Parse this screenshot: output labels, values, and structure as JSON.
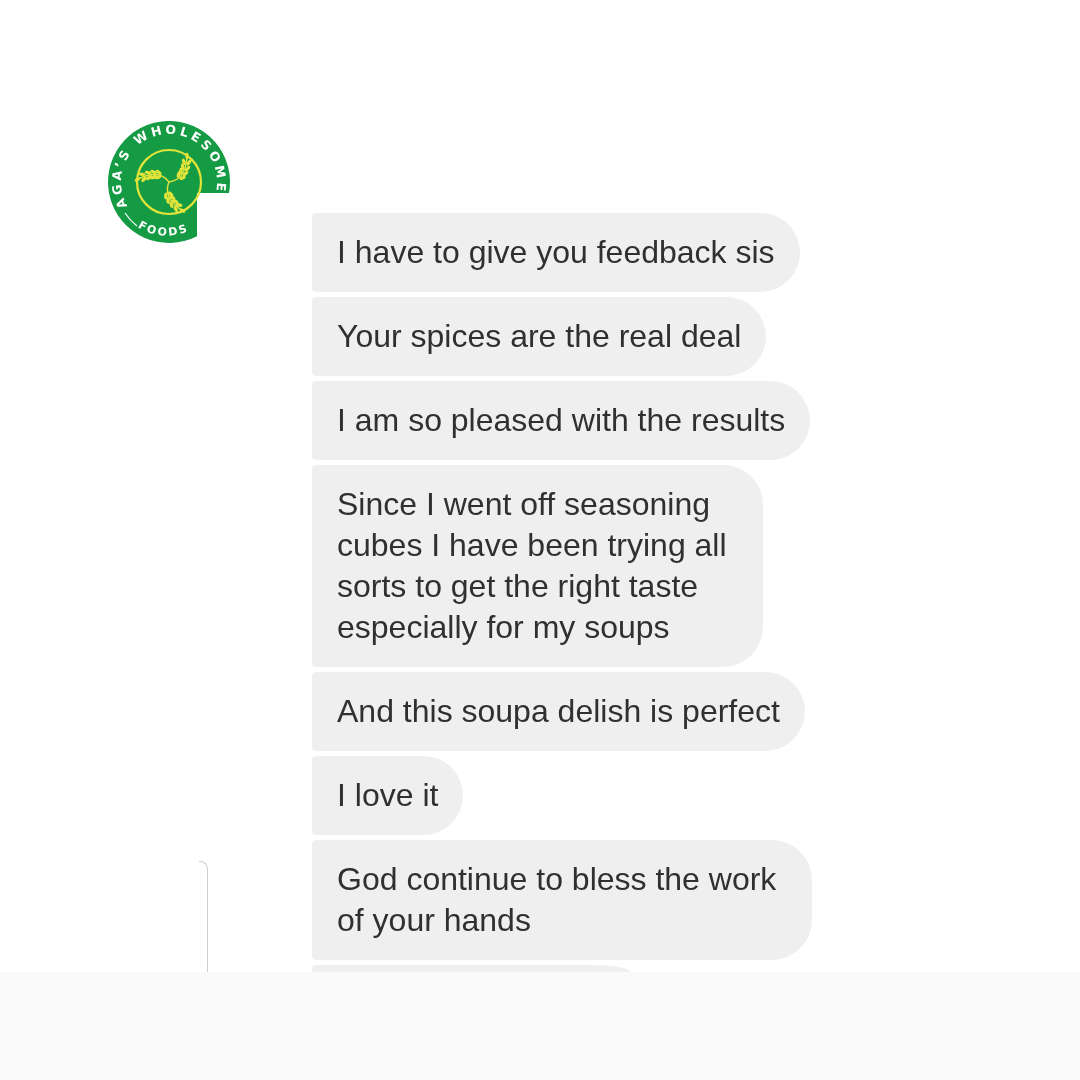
{
  "logo": {
    "top_text": "AGA’S WHOLESOME",
    "bottom_text": "FOODS"
  },
  "messages": [
    {
      "lines": [
        "I have to give you feedback sis"
      ]
    },
    {
      "lines": [
        "Your spices are the real deal"
      ]
    },
    {
      "lines": [
        "I am so pleased with the results"
      ]
    },
    {
      "lines": [
        "Since I went off seasoning",
        "cubes I have been trying all",
        "sorts to get the right taste",
        "especially for my soups"
      ]
    },
    {
      "lines": [
        "And this soupa delish is perfect"
      ]
    },
    {
      "lines": [
        "I love it"
      ]
    },
    {
      "lines": [
        "God continue to bless the work",
        "of your hands"
      ]
    }
  ]
}
